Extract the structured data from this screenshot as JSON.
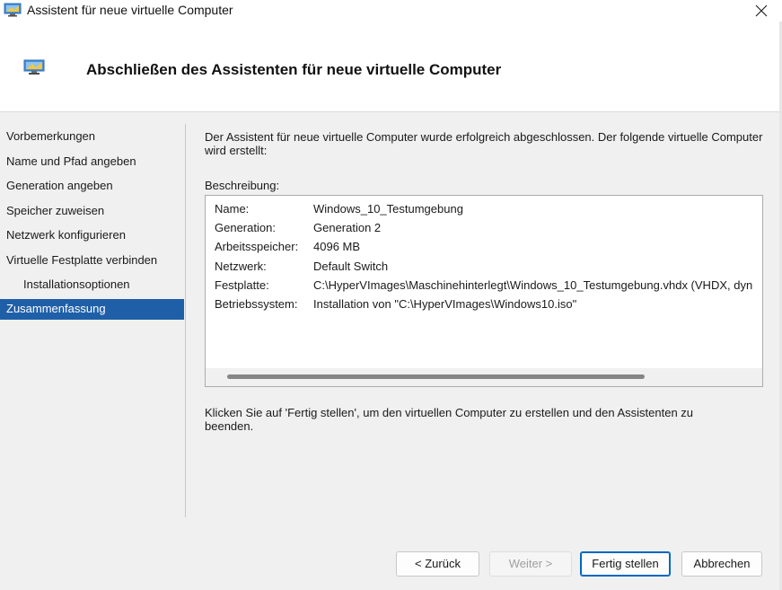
{
  "window": {
    "title": "Assistent für neue virtuelle Computer"
  },
  "header": {
    "title": "Abschließen des Assistenten für neue virtuelle Computer"
  },
  "nav": {
    "items": [
      {
        "label": "Vorbemerkungen"
      },
      {
        "label": "Name und Pfad angeben"
      },
      {
        "label": "Generation angeben"
      },
      {
        "label": "Speicher zuweisen"
      },
      {
        "label": "Netzwerk konfigurieren"
      },
      {
        "label": "Virtuelle Festplatte verbinden"
      },
      {
        "label": "Installationsoptionen"
      },
      {
        "label": "Zusammenfassung"
      }
    ]
  },
  "content": {
    "intro": "Der Assistent für neue virtuelle Computer wurde erfolgreich abgeschlossen. Der folgende virtuelle Computer wird erstellt:",
    "description_label": "Beschreibung:",
    "summary": [
      {
        "key": "Name:",
        "value": "Windows_10_Testumgebung"
      },
      {
        "key": "Generation:",
        "value": "Generation 2"
      },
      {
        "key": "Arbeitsspeicher:",
        "value": "4096 MB"
      },
      {
        "key": "Netzwerk:",
        "value": "Default Switch"
      },
      {
        "key": "Festplatte:",
        "value": "C:\\HyperVImages\\Maschinehinterlegt\\Windows_10_Testumgebung.vhdx (VHDX, dyn"
      },
      {
        "key": "Betriebssystem:",
        "value": "Installation von \"C:\\HyperVImages\\Windows10.iso\""
      }
    ],
    "finish_text": "Klicken Sie auf 'Fertig stellen', um den virtuellen Computer zu erstellen und den Assistenten zu beenden."
  },
  "buttons": {
    "back": "< Zurück",
    "next": "Weiter >",
    "finish": "Fertig stellen",
    "cancel": "Abbrechen"
  },
  "icons": {
    "app": "monitor-icon",
    "close": "close-icon"
  },
  "colors": {
    "accent": "#1f5fa8",
    "primary_border": "#0067c0"
  }
}
